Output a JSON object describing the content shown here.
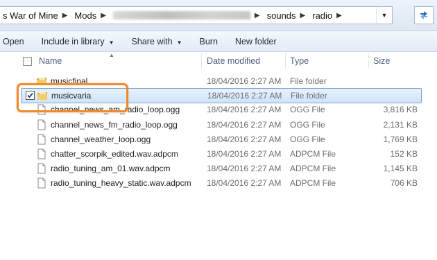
{
  "address_bar": {
    "crumbs": [
      "s War of Mine",
      "Mods",
      "sounds",
      "radio"
    ]
  },
  "toolbar": {
    "open": "Open",
    "include_in_library": "Include in library",
    "share_with": "Share with",
    "burn": "Burn",
    "new_folder": "New folder"
  },
  "columns": {
    "name": "Name",
    "date_modified": "Date modified",
    "type": "Type",
    "size": "Size"
  },
  "files": [
    {
      "name": "musicfinal",
      "date": "18/04/2016 2:27 AM",
      "type": "File folder",
      "size": "",
      "icon": "folder-icon"
    },
    {
      "name": "musicvaria",
      "date": "18/04/2016 2:27 AM",
      "type": "File folder",
      "size": "",
      "icon": "folder-icon",
      "selected": true,
      "checked": true
    },
    {
      "name": "channel_news_am_radio_loop.ogg",
      "date": "18/04/2016 2:27 AM",
      "type": "OGG File",
      "size": "3,816 KB",
      "icon": "file-icon"
    },
    {
      "name": "channel_news_fm_radio_loop.ogg",
      "date": "18/04/2016 2:27 AM",
      "type": "OGG File",
      "size": "2,131 KB",
      "icon": "file-icon"
    },
    {
      "name": "channel_weather_loop.ogg",
      "date": "18/04/2016 2:27 AM",
      "type": "OGG File",
      "size": "1,769 KB",
      "icon": "file-icon"
    },
    {
      "name": "chatter_scorpik_edited.wav.adpcm",
      "date": "18/04/2016 2:27 AM",
      "type": "ADPCM File",
      "size": "152 KB",
      "icon": "file-icon"
    },
    {
      "name": "radio_tuning_am_01.wav.adpcm",
      "date": "18/04/2016 2:27 AM",
      "type": "ADPCM File",
      "size": "1,145 KB",
      "icon": "file-icon"
    },
    {
      "name": "radio_tuning_heavy_static.wav.adpcm",
      "date": "18/04/2016 2:27 AM",
      "type": "ADPCM File",
      "size": "706 KB",
      "icon": "file-icon"
    }
  ],
  "colors": {
    "highlight": "#f08a2e",
    "selection": "#cfe3fa",
    "selection_border": "#7da2ce",
    "folder": "#e8c15a"
  }
}
